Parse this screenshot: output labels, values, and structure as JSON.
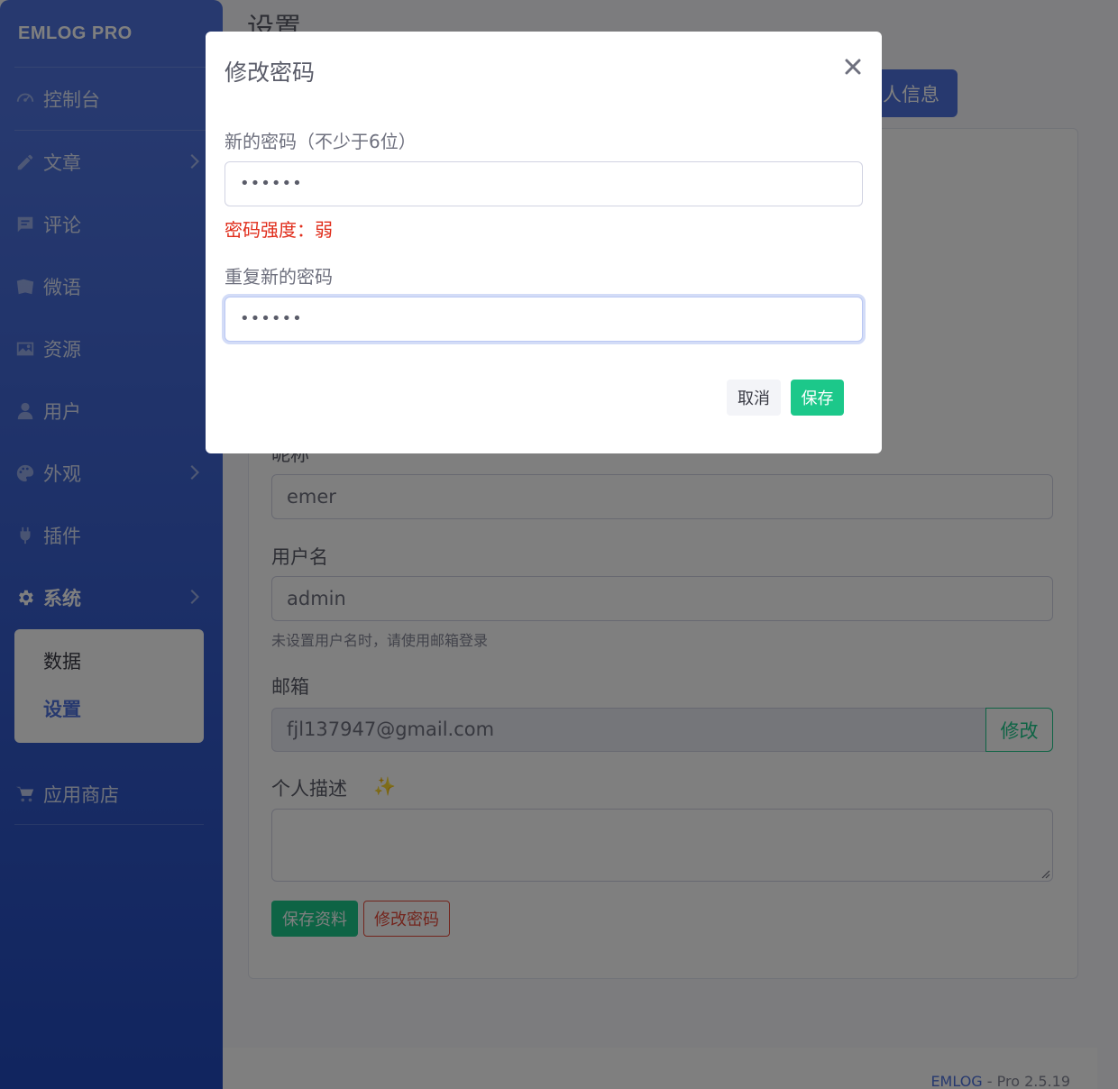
{
  "sidebar": {
    "brand": "EMLOG PRO",
    "items": [
      {
        "label": "控制台",
        "icon": "dashboard-icon"
      },
      {
        "label": "文章",
        "icon": "pencil-icon"
      },
      {
        "label": "评论",
        "icon": "comment-icon"
      },
      {
        "label": "微语",
        "icon": "note-icon"
      },
      {
        "label": "资源",
        "icon": "image-icon"
      },
      {
        "label": "用户",
        "icon": "user-icon"
      },
      {
        "label": "外观",
        "icon": "palette-icon"
      },
      {
        "label": "插件",
        "icon": "plug-icon"
      },
      {
        "label": "系统",
        "icon": "gear-icon"
      }
    ],
    "submenu": [
      "数据",
      "设置"
    ],
    "shop": "应用商店"
  },
  "main": {
    "title": "设置",
    "tab": "人信息",
    "nickname_label": "昵称",
    "nickname_value": "emer",
    "username_label": "用户名",
    "username_value": "admin",
    "username_help": "未设置用户名时，请使用邮箱登录",
    "email_label": "邮箱",
    "email_value": "fjl137947@gmail.com",
    "email_button": "修改",
    "desc_label": "个人描述",
    "save_profile": "保存资料",
    "change_password": "修改密码"
  },
  "footer": {
    "brand": "EMLOG",
    "version": " - Pro 2.5.19"
  },
  "modal": {
    "title": "修改密码",
    "new_pw_label": "新的密码（不少于6位）",
    "new_pw_value": "••••••",
    "strength": "密码强度：弱",
    "repeat_pw_label": "重复新的密码",
    "repeat_pw_value": "••••••",
    "cancel": "取消",
    "save": "保存"
  },
  "colors": {
    "primary": "#4e73df",
    "success": "#1cc88a",
    "danger": "#e74a3b"
  }
}
